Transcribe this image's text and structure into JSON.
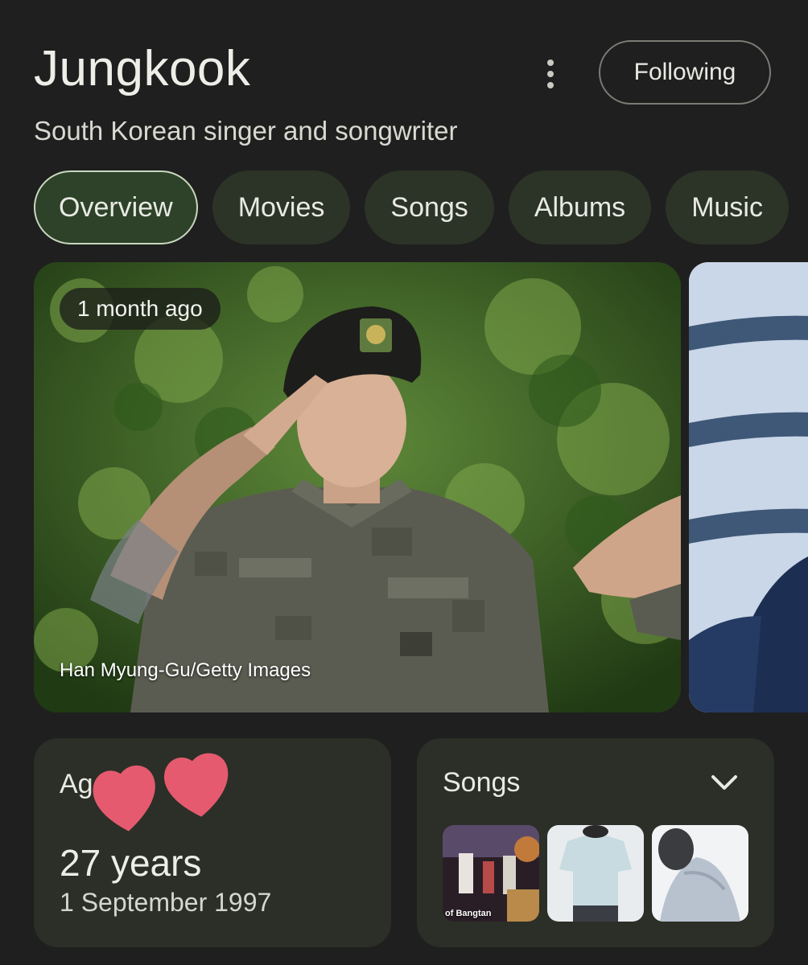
{
  "header": {
    "title": "Jungkook",
    "subtitle": "South Korean singer and songwriter",
    "more_icon": "more-vert-icon",
    "following_label": "Following"
  },
  "tabs": [
    {
      "label": "Overview",
      "active": true
    },
    {
      "label": "Movies",
      "active": false
    },
    {
      "label": "Songs",
      "active": false
    },
    {
      "label": "Albums",
      "active": false
    },
    {
      "label": "Music",
      "active": false
    }
  ],
  "hero": {
    "timestamp": "1 month ago",
    "credit": "Han Myung-Gu/Getty Images"
  },
  "age_card": {
    "label": "Age",
    "value": "27 years",
    "birth_date": "1 September 1997"
  },
  "songs_card": {
    "label": "Songs",
    "expand_icon": "chevron-down-icon",
    "thumbnails": [
      {
        "caption": "of Bangtan"
      },
      {
        "caption": ""
      },
      {
        "caption": ""
      }
    ]
  },
  "colors": {
    "background": "#1f1f1f",
    "tab_active_bg": "#2e4229",
    "tab_bg": "#2c3327",
    "card_bg": "#2b2f27",
    "heart": "#e55a6e"
  }
}
